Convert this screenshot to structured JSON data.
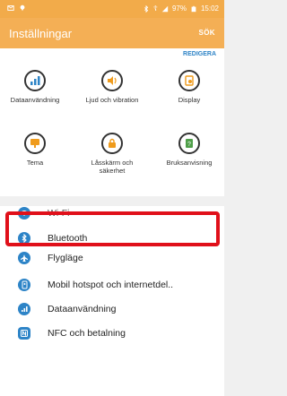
{
  "status_bar": {
    "signal": "☦",
    "battery": "97%",
    "time": "15:02"
  },
  "header": {
    "title": "Inställningar",
    "search_label": "SÖK"
  },
  "quick_settings": {
    "edit_label": "REDIGERA",
    "items": [
      {
        "label": "Dataanvändning",
        "icon": "data-usage-icon",
        "color": "#2d84c7"
      },
      {
        "label": "Ljud och vibration",
        "icon": "sound-icon",
        "color": "#ef9b1c"
      },
      {
        "label": "Display",
        "icon": "display-icon",
        "color": "#ef9b1c"
      },
      {
        "label": "Tema",
        "icon": "theme-icon",
        "color": "#ef9b1c"
      },
      {
        "label": "Låsskärm och säkerhet",
        "icon": "lock-icon",
        "color": "#ef9b1c"
      },
      {
        "label": "Bruksanvisning",
        "icon": "help-icon",
        "color": "#4f9f49"
      }
    ]
  },
  "settings_list": [
    {
      "label": "Wi-Fi",
      "icon": "wifi-icon",
      "color": "#2d84c7"
    },
    {
      "label": "Bluetooth",
      "icon": "bluetooth-icon",
      "color": "#2d84c7"
    },
    {
      "label": "Flygläge",
      "icon": "airplane-icon",
      "color": "#2d84c7"
    },
    {
      "label": "Mobil hotspot och internetdel..",
      "icon": "hotspot-icon",
      "color": "#2d84c7"
    },
    {
      "label": "Dataanvändning",
      "icon": "data-usage-icon",
      "color": "#2d84c7"
    },
    {
      "label": "NFC och betalning",
      "icon": "nfc-icon",
      "color": "#2d84c7"
    }
  ],
  "highlight_color": "#e0101a"
}
